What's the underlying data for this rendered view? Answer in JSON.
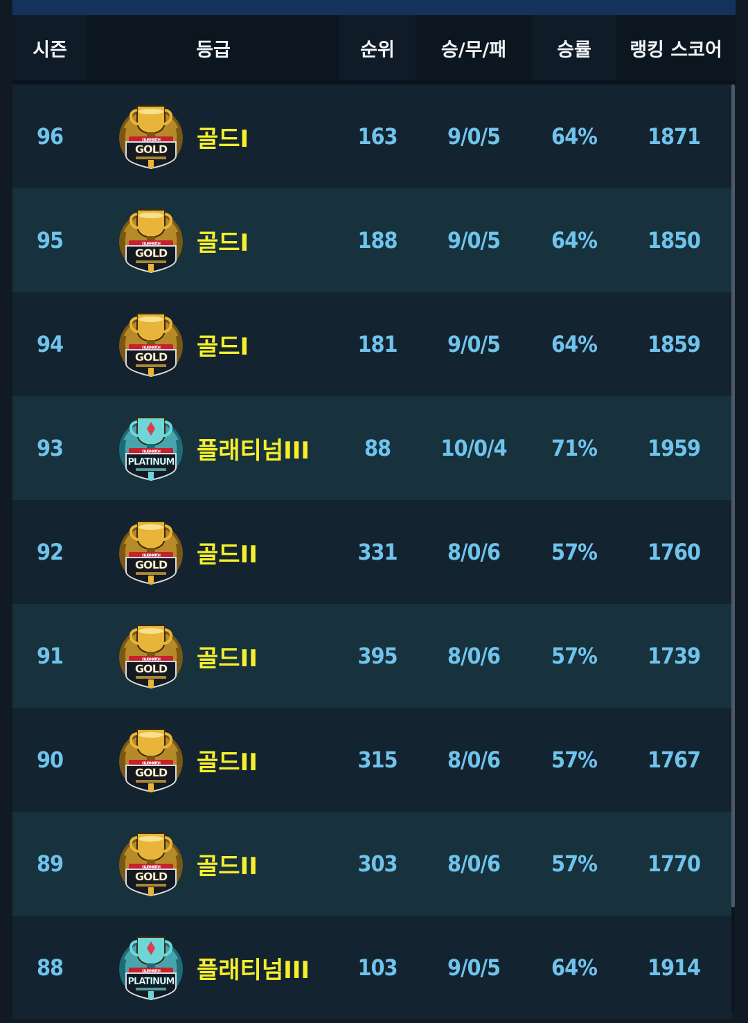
{
  "table": {
    "headers": {
      "season": "시즌",
      "grade": "등급",
      "rank": "순위",
      "wdl": "승/무/패",
      "win_rate": "승률",
      "ranking_score": "랭킹 스코어"
    },
    "rows": [
      {
        "season": "96",
        "badge": "gold-badge-icon",
        "grade": "골드I",
        "rank": "163",
        "wdl": "9/0/5",
        "win_rate": "64%",
        "score": "1871"
      },
      {
        "season": "95",
        "badge": "gold-badge-icon",
        "grade": "골드I",
        "rank": "188",
        "wdl": "9/0/5",
        "win_rate": "64%",
        "score": "1850"
      },
      {
        "season": "94",
        "badge": "gold-badge-icon",
        "grade": "골드I",
        "rank": "181",
        "wdl": "9/0/5",
        "win_rate": "64%",
        "score": "1859"
      },
      {
        "season": "93",
        "badge": "platinum-badge-icon",
        "grade": "플래티넘III",
        "rank": "88",
        "wdl": "10/0/4",
        "win_rate": "71%",
        "score": "1959"
      },
      {
        "season": "92",
        "badge": "gold-badge-icon",
        "grade": "골드II",
        "rank": "331",
        "wdl": "8/0/6",
        "win_rate": "57%",
        "score": "1760"
      },
      {
        "season": "91",
        "badge": "gold-badge-icon",
        "grade": "골드II",
        "rank": "395",
        "wdl": "8/0/6",
        "win_rate": "57%",
        "score": "1739"
      },
      {
        "season": "90",
        "badge": "gold-badge-icon",
        "grade": "골드II",
        "rank": "315",
        "wdl": "8/0/6",
        "win_rate": "57%",
        "score": "1767"
      },
      {
        "season": "89",
        "badge": "gold-badge-icon",
        "grade": "골드II",
        "rank": "303",
        "wdl": "8/0/6",
        "win_rate": "57%",
        "score": "1770"
      },
      {
        "season": "88",
        "badge": "platinum-badge-icon",
        "grade": "플래티넘III",
        "rank": "103",
        "wdl": "9/0/5",
        "win_rate": "64%",
        "score": "1914"
      }
    ]
  },
  "badges": {
    "gold": {
      "word": "GOLD",
      "banner": "CLUB MATCH",
      "primary": "#e8b53a",
      "dark": "#7a5714",
      "ribbon": "#c8202f"
    },
    "platinum": {
      "word": "PLATINUM",
      "banner": "CLUB MATCH",
      "primary": "#6fd6d8",
      "dark": "#1c6c78",
      "ribbon": "#c8202f"
    }
  },
  "colors": {
    "grade_text": "#f6ef2c",
    "value_text": "#6fc3ec",
    "header_text": "#f2f4f7"
  }
}
